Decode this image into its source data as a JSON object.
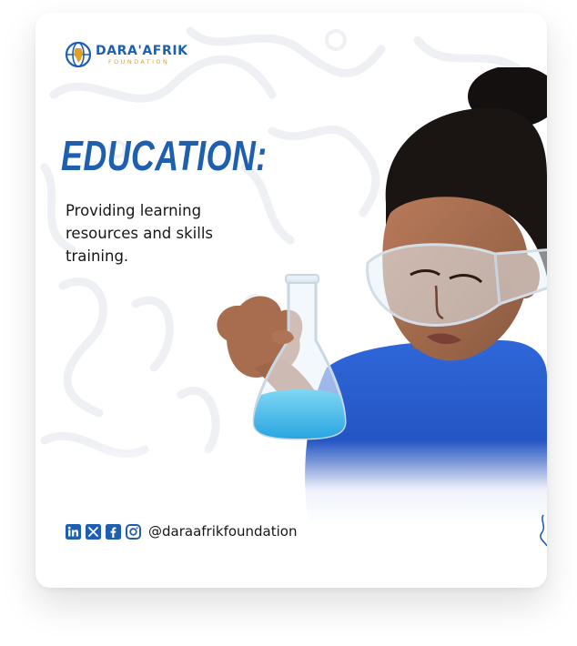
{
  "brand": {
    "name": "DARA'AFRIK",
    "sub": "FOUNDATION",
    "primary_color": "#1f5fb0",
    "accent_color": "#e2a024"
  },
  "headline": "EDUCATION:",
  "subhead": "Providing learning resources and skills training.",
  "photo": {
    "icon": "girl-with-lab-flask-illustration"
  },
  "social": {
    "icons": [
      "linkedin-icon",
      "x-icon",
      "facebook-icon",
      "instagram-icon"
    ],
    "handle": "@daraafrikfoundation"
  }
}
